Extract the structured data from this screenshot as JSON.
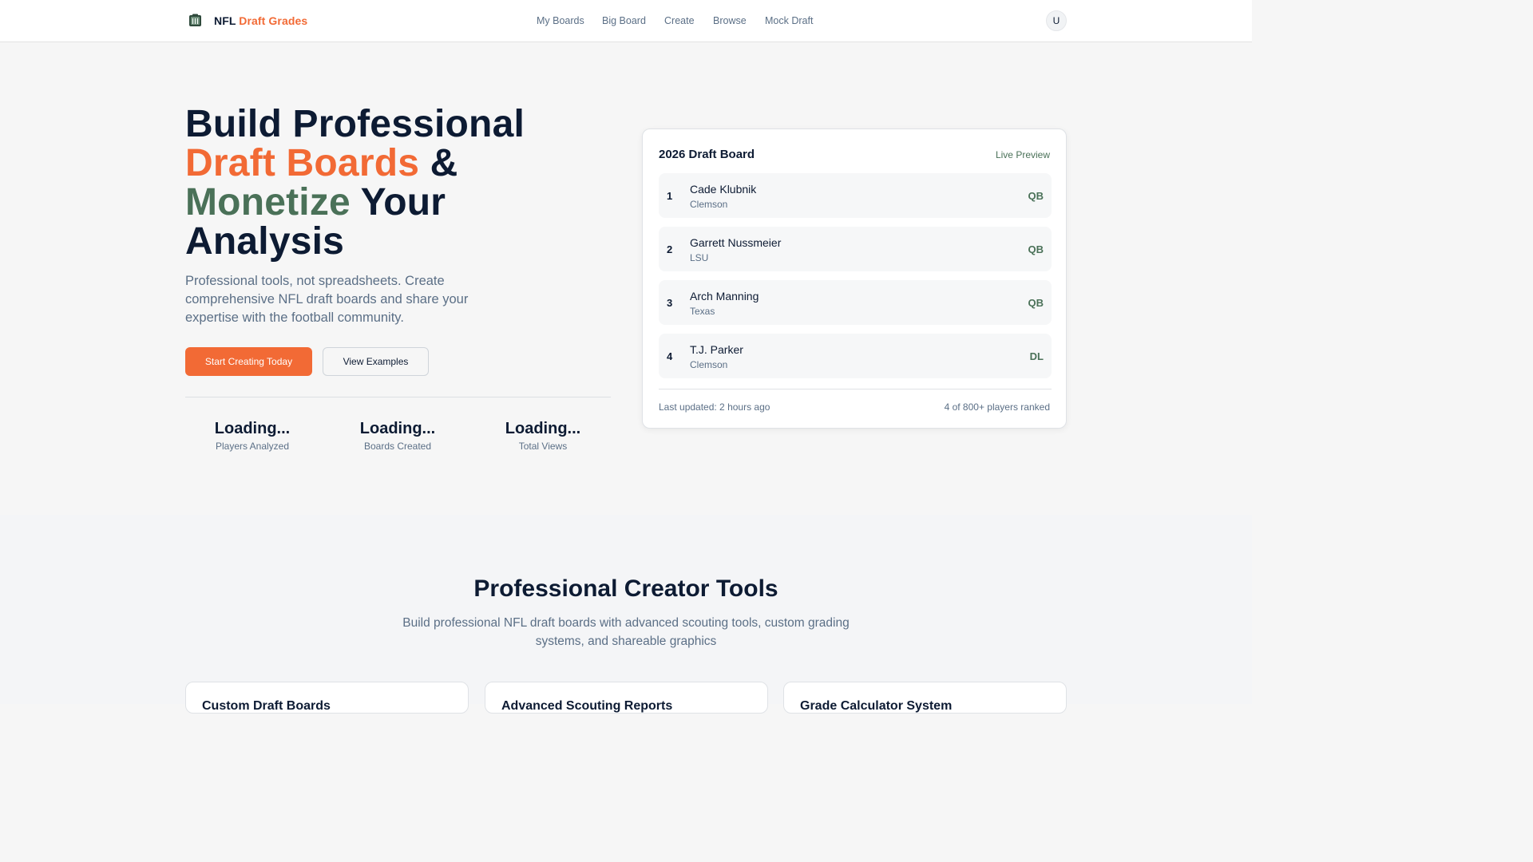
{
  "header": {
    "brand_part1": "NFL",
    "brand_part2": "Draft Grades",
    "logo_icon": "clipboard-board-icon",
    "nav": [
      "My Boards",
      "Big Board",
      "Create",
      "Browse",
      "Mock Draft"
    ],
    "avatar_initial": "U"
  },
  "hero": {
    "title": {
      "line1": "Build Professional",
      "line2_accent": "Draft Boards",
      "line2_rest": " &",
      "line3_accent": "Monetize",
      "line3_rest": " Your",
      "line4": "Analysis"
    },
    "subtitle": "Professional tools, not spreadsheets. Create comprehensive NFL draft boards and share your expertise with the football community.",
    "primary_cta": "Start Creating Today",
    "secondary_cta": "View Examples",
    "stats": [
      {
        "value": "Loading...",
        "label": "Players Analyzed"
      },
      {
        "value": "Loading...",
        "label": "Boards Created"
      },
      {
        "value": "Loading...",
        "label": "Total Views"
      }
    ]
  },
  "board": {
    "title": "2026 Draft Board",
    "badge": "Live Preview",
    "players": [
      {
        "rank": "1",
        "name": "Cade Klubnik",
        "school": "Clemson",
        "position": "QB"
      },
      {
        "rank": "2",
        "name": "Garrett Nussmeier",
        "school": "LSU",
        "position": "QB"
      },
      {
        "rank": "3",
        "name": "Arch Manning",
        "school": "Texas",
        "position": "QB"
      },
      {
        "rank": "4",
        "name": "T.J. Parker",
        "school": "Clemson",
        "position": "DL"
      }
    ],
    "updated": "Last updated: 2 hours ago",
    "count": "4 of 800+ players ranked"
  },
  "tools": {
    "title": "Professional Creator Tools",
    "subtitle": "Build professional NFL draft boards with advanced scouting tools, custom grading systems, and shareable graphics",
    "cards": [
      "Custom Draft Boards",
      "Advanced Scouting Reports",
      "Grade Calculator System"
    ]
  },
  "colors": {
    "accent_orange": "#f26a35",
    "accent_green": "#4a7158",
    "navy": "#0d1b33",
    "muted": "#5b6f86"
  }
}
